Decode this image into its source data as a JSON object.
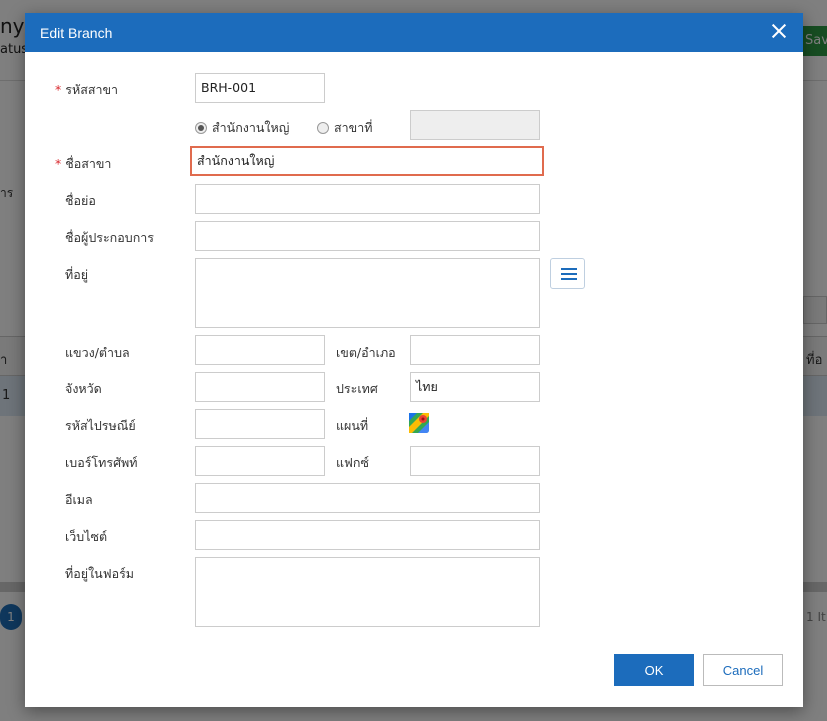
{
  "background": {
    "title": "ny",
    "status": "atus",
    "save_label": "Sav",
    "side_label": "าร",
    "grid_head_left": "า",
    "grid_head_right": "ที่อ",
    "grid_row_value": "1",
    "pager_page": "1",
    "items_text": "1 It"
  },
  "modal": {
    "title": "Edit Branch",
    "fields": {
      "branch_code_label": "รหัสสาขา",
      "branch_code_value": "BRH-001",
      "radio_head_office": "สำนักงานใหญ่",
      "radio_branch_no": "สาขาที่",
      "branch_name_label": "ชื่อสาขา",
      "branch_name_value": "สำนักงานใหญ่",
      "short_name_label": "ชื่อย่อ",
      "operator_name_label": "ชื่อผู้ประกอบการ",
      "address_label": "ที่อยู่",
      "subdistrict_label": "แขวง/ตำบล",
      "district_label": "เขต/อำเภอ",
      "province_label": "จังหวัด",
      "country_label": "ประเทศ",
      "country_value": "ไทย",
      "postcode_label": "รหัสไปรษณีย์",
      "map_label": "แผนที่",
      "phone_label": "เบอร์โทรศัพท์",
      "fax_label": "แฟกซ์",
      "email_label": "อีเมล",
      "website_label": "เว็บไซต์",
      "form_address_label": "ที่อยู่ในฟอร์ม"
    },
    "buttons": {
      "ok": "OK",
      "cancel": "Cancel"
    },
    "icons": {
      "close": "close-icon",
      "address_list": "list-icon",
      "map": "google-maps-icon"
    },
    "colors": {
      "header": "#1c6cbc",
      "required": "#d9292e",
      "focus_border": "#e06b4e"
    }
  }
}
